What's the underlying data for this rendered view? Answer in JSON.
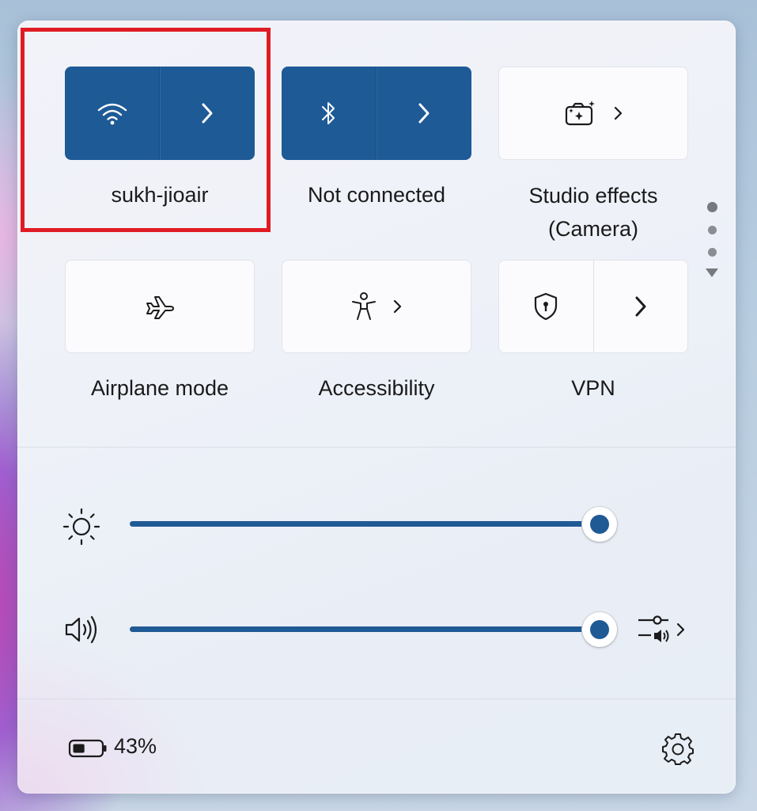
{
  "tiles": {
    "wifi": {
      "label": "sukh-jioair",
      "icon": "wifi-icon",
      "active": true
    },
    "bluetooth": {
      "label": "Not connected",
      "icon": "bluetooth-icon",
      "active": true
    },
    "studio_effects": {
      "label_line1": "Studio effects",
      "label_line2": "(Camera)",
      "icon": "camera-effects-icon"
    },
    "airplane": {
      "label": "Airplane mode",
      "icon": "airplane-icon"
    },
    "accessibility": {
      "label": "Accessibility",
      "icon": "accessibility-icon"
    },
    "vpn": {
      "label": "VPN",
      "icon": "shield-icon"
    }
  },
  "brightness": {
    "icon": "brightness-icon",
    "level": 1.0
  },
  "volume": {
    "icon": "volume-icon",
    "level": 1.0,
    "mixer_icon": "audio-mixer-icon"
  },
  "footer": {
    "battery_percent": "43%",
    "battery_icon": "battery-icon",
    "settings_icon": "gear-icon"
  },
  "pager": {
    "pages": 3,
    "current": 0
  },
  "colors": {
    "accent": "#1e5a96",
    "highlight": "#e01b24"
  }
}
